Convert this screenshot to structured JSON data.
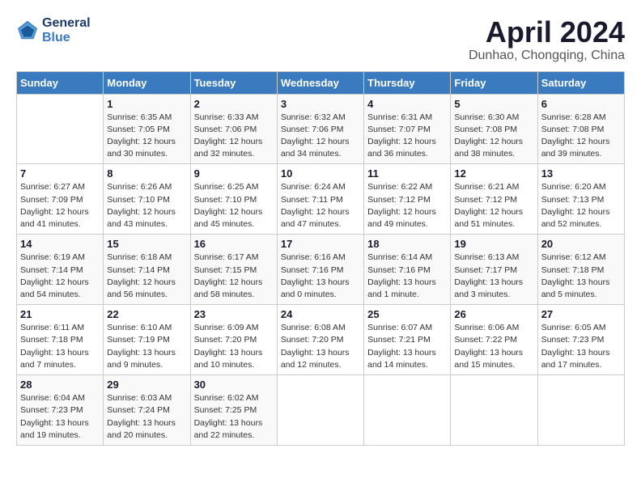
{
  "logo": {
    "line1": "General",
    "line2": "Blue"
  },
  "title": "April 2024",
  "location": "Dunhao, Chongqing, China",
  "days_of_week": [
    "Sunday",
    "Monday",
    "Tuesday",
    "Wednesday",
    "Thursday",
    "Friday",
    "Saturday"
  ],
  "weeks": [
    [
      {
        "day": "",
        "info": ""
      },
      {
        "day": "1",
        "info": "Sunrise: 6:35 AM\nSunset: 7:05 PM\nDaylight: 12 hours\nand 30 minutes."
      },
      {
        "day": "2",
        "info": "Sunrise: 6:33 AM\nSunset: 7:06 PM\nDaylight: 12 hours\nand 32 minutes."
      },
      {
        "day": "3",
        "info": "Sunrise: 6:32 AM\nSunset: 7:06 PM\nDaylight: 12 hours\nand 34 minutes."
      },
      {
        "day": "4",
        "info": "Sunrise: 6:31 AM\nSunset: 7:07 PM\nDaylight: 12 hours\nand 36 minutes."
      },
      {
        "day": "5",
        "info": "Sunrise: 6:30 AM\nSunset: 7:08 PM\nDaylight: 12 hours\nand 38 minutes."
      },
      {
        "day": "6",
        "info": "Sunrise: 6:28 AM\nSunset: 7:08 PM\nDaylight: 12 hours\nand 39 minutes."
      }
    ],
    [
      {
        "day": "7",
        "info": "Sunrise: 6:27 AM\nSunset: 7:09 PM\nDaylight: 12 hours\nand 41 minutes."
      },
      {
        "day": "8",
        "info": "Sunrise: 6:26 AM\nSunset: 7:10 PM\nDaylight: 12 hours\nand 43 minutes."
      },
      {
        "day": "9",
        "info": "Sunrise: 6:25 AM\nSunset: 7:10 PM\nDaylight: 12 hours\nand 45 minutes."
      },
      {
        "day": "10",
        "info": "Sunrise: 6:24 AM\nSunset: 7:11 PM\nDaylight: 12 hours\nand 47 minutes."
      },
      {
        "day": "11",
        "info": "Sunrise: 6:22 AM\nSunset: 7:12 PM\nDaylight: 12 hours\nand 49 minutes."
      },
      {
        "day": "12",
        "info": "Sunrise: 6:21 AM\nSunset: 7:12 PM\nDaylight: 12 hours\nand 51 minutes."
      },
      {
        "day": "13",
        "info": "Sunrise: 6:20 AM\nSunset: 7:13 PM\nDaylight: 12 hours\nand 52 minutes."
      }
    ],
    [
      {
        "day": "14",
        "info": "Sunrise: 6:19 AM\nSunset: 7:14 PM\nDaylight: 12 hours\nand 54 minutes."
      },
      {
        "day": "15",
        "info": "Sunrise: 6:18 AM\nSunset: 7:14 PM\nDaylight: 12 hours\nand 56 minutes."
      },
      {
        "day": "16",
        "info": "Sunrise: 6:17 AM\nSunset: 7:15 PM\nDaylight: 12 hours\nand 58 minutes."
      },
      {
        "day": "17",
        "info": "Sunrise: 6:16 AM\nSunset: 7:16 PM\nDaylight: 13 hours\nand 0 minutes."
      },
      {
        "day": "18",
        "info": "Sunrise: 6:14 AM\nSunset: 7:16 PM\nDaylight: 13 hours\nand 1 minute."
      },
      {
        "day": "19",
        "info": "Sunrise: 6:13 AM\nSunset: 7:17 PM\nDaylight: 13 hours\nand 3 minutes."
      },
      {
        "day": "20",
        "info": "Sunrise: 6:12 AM\nSunset: 7:18 PM\nDaylight: 13 hours\nand 5 minutes."
      }
    ],
    [
      {
        "day": "21",
        "info": "Sunrise: 6:11 AM\nSunset: 7:18 PM\nDaylight: 13 hours\nand 7 minutes."
      },
      {
        "day": "22",
        "info": "Sunrise: 6:10 AM\nSunset: 7:19 PM\nDaylight: 13 hours\nand 9 minutes."
      },
      {
        "day": "23",
        "info": "Sunrise: 6:09 AM\nSunset: 7:20 PM\nDaylight: 13 hours\nand 10 minutes."
      },
      {
        "day": "24",
        "info": "Sunrise: 6:08 AM\nSunset: 7:20 PM\nDaylight: 13 hours\nand 12 minutes."
      },
      {
        "day": "25",
        "info": "Sunrise: 6:07 AM\nSunset: 7:21 PM\nDaylight: 13 hours\nand 14 minutes."
      },
      {
        "day": "26",
        "info": "Sunrise: 6:06 AM\nSunset: 7:22 PM\nDaylight: 13 hours\nand 15 minutes."
      },
      {
        "day": "27",
        "info": "Sunrise: 6:05 AM\nSunset: 7:23 PM\nDaylight: 13 hours\nand 17 minutes."
      }
    ],
    [
      {
        "day": "28",
        "info": "Sunrise: 6:04 AM\nSunset: 7:23 PM\nDaylight: 13 hours\nand 19 minutes."
      },
      {
        "day": "29",
        "info": "Sunrise: 6:03 AM\nSunset: 7:24 PM\nDaylight: 13 hours\nand 20 minutes."
      },
      {
        "day": "30",
        "info": "Sunrise: 6:02 AM\nSunset: 7:25 PM\nDaylight: 13 hours\nand 22 minutes."
      },
      {
        "day": "",
        "info": ""
      },
      {
        "day": "",
        "info": ""
      },
      {
        "day": "",
        "info": ""
      },
      {
        "day": "",
        "info": ""
      }
    ]
  ]
}
